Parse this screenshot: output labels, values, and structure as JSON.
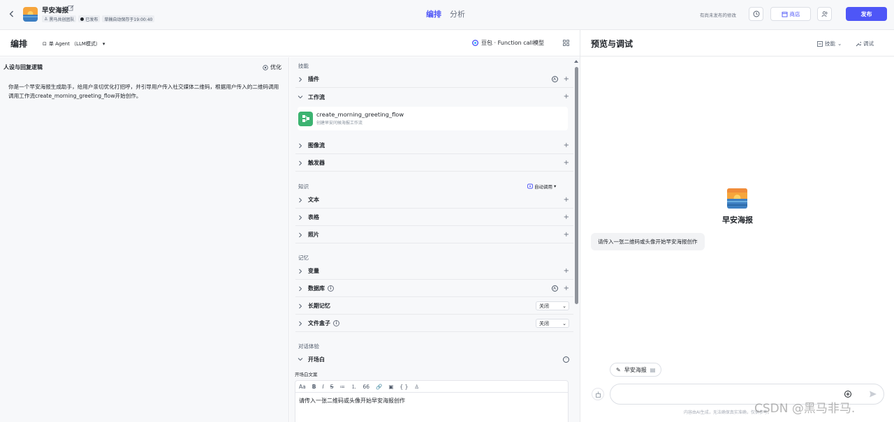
{
  "header": {
    "app_title": "早安海报",
    "tags": {
      "team": "黑马共创团队",
      "status": "已发布",
      "autosave": "草稿自动保存于19:00:40"
    },
    "nav_tabs": [
      "编排",
      "分析"
    ],
    "unpublished_note": "有尚未发布的修改",
    "store_label": "商店",
    "publish_label": "发布"
  },
  "editbar": {
    "title": "编排",
    "agent_mode": "单 Agent （LLM模式）",
    "model": "豆包 · Function call模型"
  },
  "persona": {
    "title": "人设与回复逻辑",
    "optimize_label": "优化",
    "text": "你是一个早安海报生成助手，给用户亲切优化打招呼，并引导用户传入社交媒体二维码，根据用户传入的二维码调用调用工作流create_morning_greeting_flow开始创作。"
  },
  "skills": {
    "section_skills": "技能",
    "plugin": "插件",
    "workflow": "工作流",
    "workflow_item": {
      "name": "create_morning_greeting_flow",
      "desc": "创建早安问候海报工作流"
    },
    "image_flow": "图像流",
    "trigger": "触发器",
    "section_knowledge": "知识",
    "auto_call": "自动调用",
    "text": "文本",
    "table": "表格",
    "photo": "照片",
    "section_memory": "记忆",
    "variable": "变量",
    "database": "数据库",
    "long_memory": "长期记忆",
    "long_memory_value": "关闭",
    "file_box": "文件盒子",
    "file_box_value": "关闭",
    "section_dialog": "对话体验",
    "opener": "开场白",
    "opener_label": "开场白文案",
    "opener_text": "请传入一张二维码或头像开始早安海报创作",
    "toolbar": [
      "Aa",
      "B",
      "I",
      "S",
      "≔",
      "⒈",
      "66",
      "🔗",
      "▣",
      "{ }",
      "♙"
    ]
  },
  "preview": {
    "title": "预览与调试",
    "skill_label": "技能",
    "debug_label": "调试",
    "bot_name": "早安海报",
    "greeting": "请传入一张二维码或头像开始早安海报创作",
    "chip_label": "早安海报",
    "disclaimer": "内容由AI生成，无法确保真实准确，仅供参考。"
  },
  "watermark": "CSDN @黑马非马.",
  "colors": {
    "accent": "#4e56f7",
    "workflow_icon": "#3cb371"
  }
}
